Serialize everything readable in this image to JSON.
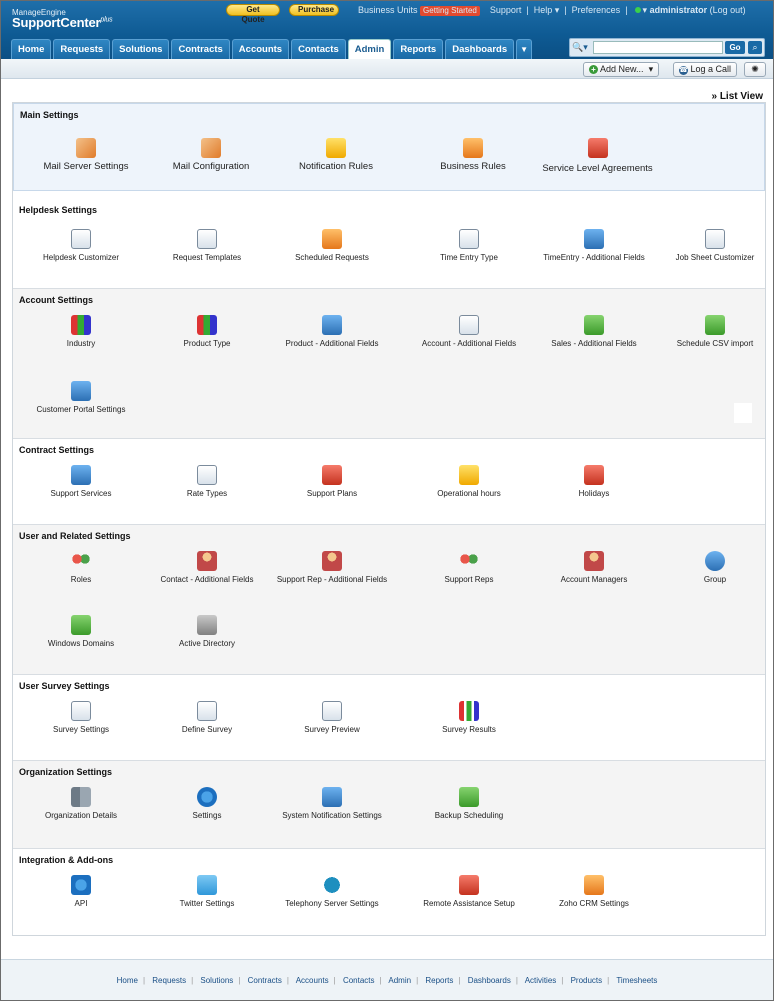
{
  "header": {
    "brand_small": "ManageEngine",
    "brand": "SupportCenter",
    "brand_sup": "plus",
    "get_quote": "Get Quote",
    "purchase": "Purchase",
    "business_units": "Business Units",
    "getting_started": "Getting Started",
    "support": "Support",
    "help": "Help",
    "preferences": "Preferences",
    "user": "administrator",
    "logout": "(Log out)"
  },
  "tabs": [
    "Home",
    "Requests",
    "Solutions",
    "Contracts",
    "Accounts",
    "Contacts",
    "Admin",
    "Reports",
    "Dashboards"
  ],
  "active_tab": "Admin",
  "search": {
    "go": "Go",
    "placeholder": ""
  },
  "actions": {
    "add_new": "Add New...",
    "log_call": "Log a Call"
  },
  "list_view": "» List View",
  "sections": [
    {
      "title": "Main Settings",
      "items": [
        "Mail Server Settings",
        "Mail Configuration",
        "Notification Rules",
        "Business Rules",
        "Service Level Agreements"
      ]
    },
    {
      "title": "Helpdesk Settings",
      "items": [
        "Helpdesk Customizer",
        "Request Templates",
        "Scheduled Requests",
        "Time Entry Type",
        "TimeEntry - Additional Fields",
        "Job Sheet Customizer"
      ]
    },
    {
      "title": "Account Settings",
      "items": [
        "Industry",
        "Product Type",
        "Product - Additional Fields",
        "Account - Additional Fields",
        "Sales - Additional Fields",
        "Schedule CSV import",
        "Customer Portal Settings"
      ]
    },
    {
      "title": "Contract Settings",
      "items": [
        "Support Services",
        "Rate Types",
        "Support Plans",
        "Operational hours",
        "Holidays"
      ]
    },
    {
      "title": "User and Related Settings",
      "items": [
        "Roles",
        "Contact - Additional Fields",
        "Support Rep - Additional Fields",
        "Support Reps",
        "Account Managers",
        "Group",
        "Windows Domains",
        "Active Directory"
      ]
    },
    {
      "title": "User Survey Settings",
      "items": [
        "Survey Settings",
        "Define Survey",
        "Survey Preview",
        "Survey Results"
      ]
    },
    {
      "title": "Organization Settings",
      "items": [
        "Organization Details",
        "Settings",
        "System Notification Settings",
        "Backup Scheduling"
      ]
    },
    {
      "title": "Integration & Add-ons",
      "items": [
        "API",
        "Twitter Settings",
        "Telephony Server Settings",
        "Remote Assistance Setup",
        "Zoho CRM Settings"
      ]
    }
  ],
  "footer": [
    "Home",
    "Requests",
    "Solutions",
    "Contracts",
    "Accounts",
    "Contacts",
    "Admin",
    "Reports",
    "Dashboards",
    "Activities",
    "Products",
    "Timesheets"
  ]
}
